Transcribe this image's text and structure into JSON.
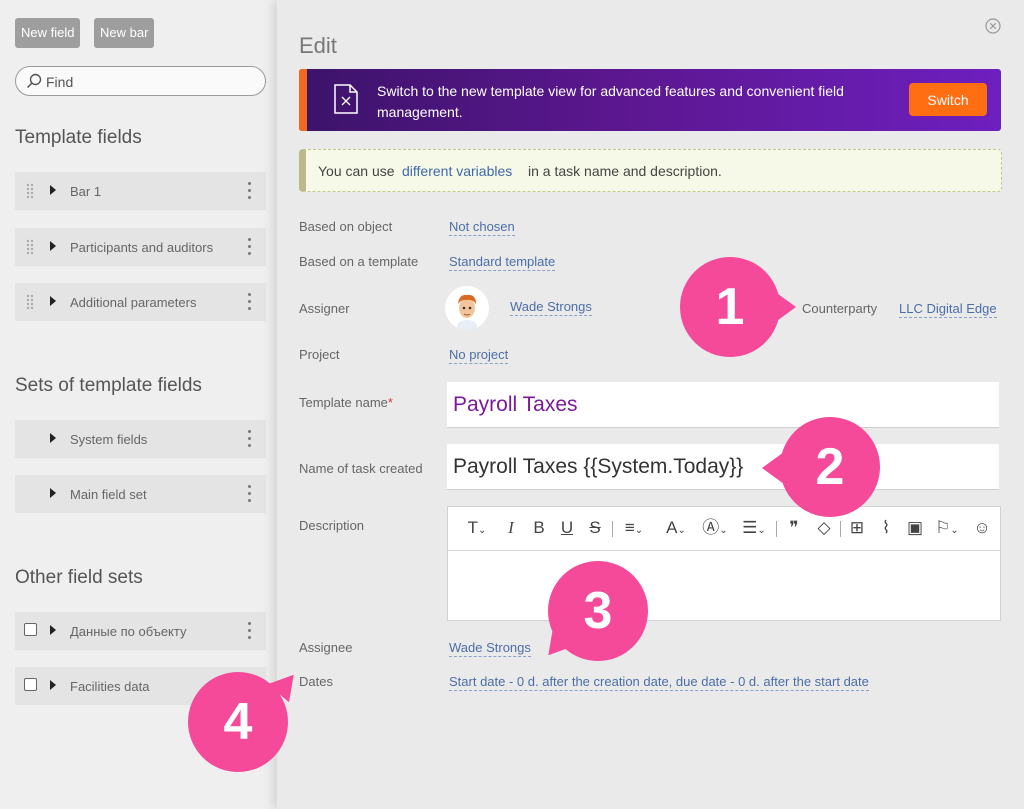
{
  "sidebar": {
    "new_field": "New field",
    "new_bar": "New bar",
    "search_placeholder": "Find",
    "template_fields_title": "Template fields",
    "template_fields": [
      "Bar 1",
      "Participants and auditors",
      "Additional parameters"
    ],
    "sets_title": "Sets of template fields",
    "sets": [
      "System fields",
      "Main field set"
    ],
    "other_title": "Other field sets",
    "other": [
      "Данные по объекту",
      "Facilities data"
    ]
  },
  "panel": {
    "title": "Edit",
    "banner_text": "Switch to the new template view for advanced features and convenient field management.",
    "banner_button": "Switch",
    "info_before": "You can use",
    "info_link": "different variables",
    "info_after": "in a task name and description.",
    "based_on_object_label": "Based on object",
    "based_on_object_value": "Not chosen",
    "based_on_template_label": "Based on a template",
    "based_on_template_value": "Standard template",
    "assigner_label": "Assigner",
    "assigner_value": "Wade Strongs",
    "counterparty_label": "Counterparty",
    "counterparty_value": "LLC Digital Edge",
    "project_label": "Project",
    "project_value": "No project",
    "template_name_label": "Template name",
    "required_mark": "*",
    "template_name_value": "Payroll Taxes",
    "task_name_label": "Name of task created",
    "task_name_value": "Payroll Taxes {{System.Today}}",
    "description_label": "Description",
    "assignee_label": "Assignee",
    "assignee_value": "Wade Strongs",
    "dates_label": "Dates",
    "dates_value": "Start date - 0 d. after the creation date, due date - 0 d. after the start date"
  },
  "badges": [
    "1",
    "2",
    "3",
    "4"
  ],
  "colors": {
    "badge": "#f5499a",
    "banner_start": "#3c136a",
    "banner_end": "#6e1fbf",
    "switch_button": "#ff6e13",
    "link": "#4c6ea6",
    "template_name_text": "#7a1a9b"
  }
}
